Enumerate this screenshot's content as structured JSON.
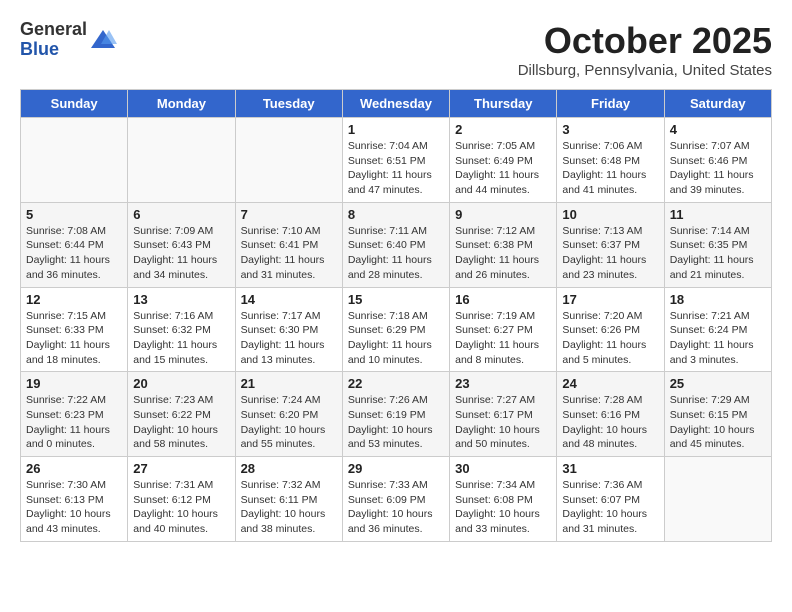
{
  "header": {
    "logo_general": "General",
    "logo_blue": "Blue",
    "month_title": "October 2025",
    "subtitle": "Dillsburg, Pennsylvania, United States"
  },
  "days_of_week": [
    "Sunday",
    "Monday",
    "Tuesday",
    "Wednesday",
    "Thursday",
    "Friday",
    "Saturday"
  ],
  "weeks": [
    [
      {
        "day": "",
        "info": ""
      },
      {
        "day": "",
        "info": ""
      },
      {
        "day": "",
        "info": ""
      },
      {
        "day": "1",
        "info": "Sunrise: 7:04 AM\nSunset: 6:51 PM\nDaylight: 11 hours and 47 minutes."
      },
      {
        "day": "2",
        "info": "Sunrise: 7:05 AM\nSunset: 6:49 PM\nDaylight: 11 hours and 44 minutes."
      },
      {
        "day": "3",
        "info": "Sunrise: 7:06 AM\nSunset: 6:48 PM\nDaylight: 11 hours and 41 minutes."
      },
      {
        "day": "4",
        "info": "Sunrise: 7:07 AM\nSunset: 6:46 PM\nDaylight: 11 hours and 39 minutes."
      }
    ],
    [
      {
        "day": "5",
        "info": "Sunrise: 7:08 AM\nSunset: 6:44 PM\nDaylight: 11 hours and 36 minutes."
      },
      {
        "day": "6",
        "info": "Sunrise: 7:09 AM\nSunset: 6:43 PM\nDaylight: 11 hours and 34 minutes."
      },
      {
        "day": "7",
        "info": "Sunrise: 7:10 AM\nSunset: 6:41 PM\nDaylight: 11 hours and 31 minutes."
      },
      {
        "day": "8",
        "info": "Sunrise: 7:11 AM\nSunset: 6:40 PM\nDaylight: 11 hours and 28 minutes."
      },
      {
        "day": "9",
        "info": "Sunrise: 7:12 AM\nSunset: 6:38 PM\nDaylight: 11 hours and 26 minutes."
      },
      {
        "day": "10",
        "info": "Sunrise: 7:13 AM\nSunset: 6:37 PM\nDaylight: 11 hours and 23 minutes."
      },
      {
        "day": "11",
        "info": "Sunrise: 7:14 AM\nSunset: 6:35 PM\nDaylight: 11 hours and 21 minutes."
      }
    ],
    [
      {
        "day": "12",
        "info": "Sunrise: 7:15 AM\nSunset: 6:33 PM\nDaylight: 11 hours and 18 minutes."
      },
      {
        "day": "13",
        "info": "Sunrise: 7:16 AM\nSunset: 6:32 PM\nDaylight: 11 hours and 15 minutes."
      },
      {
        "day": "14",
        "info": "Sunrise: 7:17 AM\nSunset: 6:30 PM\nDaylight: 11 hours and 13 minutes."
      },
      {
        "day": "15",
        "info": "Sunrise: 7:18 AM\nSunset: 6:29 PM\nDaylight: 11 hours and 10 minutes."
      },
      {
        "day": "16",
        "info": "Sunrise: 7:19 AM\nSunset: 6:27 PM\nDaylight: 11 hours and 8 minutes."
      },
      {
        "day": "17",
        "info": "Sunrise: 7:20 AM\nSunset: 6:26 PM\nDaylight: 11 hours and 5 minutes."
      },
      {
        "day": "18",
        "info": "Sunrise: 7:21 AM\nSunset: 6:24 PM\nDaylight: 11 hours and 3 minutes."
      }
    ],
    [
      {
        "day": "19",
        "info": "Sunrise: 7:22 AM\nSunset: 6:23 PM\nDaylight: 11 hours and 0 minutes."
      },
      {
        "day": "20",
        "info": "Sunrise: 7:23 AM\nSunset: 6:22 PM\nDaylight: 10 hours and 58 minutes."
      },
      {
        "day": "21",
        "info": "Sunrise: 7:24 AM\nSunset: 6:20 PM\nDaylight: 10 hours and 55 minutes."
      },
      {
        "day": "22",
        "info": "Sunrise: 7:26 AM\nSunset: 6:19 PM\nDaylight: 10 hours and 53 minutes."
      },
      {
        "day": "23",
        "info": "Sunrise: 7:27 AM\nSunset: 6:17 PM\nDaylight: 10 hours and 50 minutes."
      },
      {
        "day": "24",
        "info": "Sunrise: 7:28 AM\nSunset: 6:16 PM\nDaylight: 10 hours and 48 minutes."
      },
      {
        "day": "25",
        "info": "Sunrise: 7:29 AM\nSunset: 6:15 PM\nDaylight: 10 hours and 45 minutes."
      }
    ],
    [
      {
        "day": "26",
        "info": "Sunrise: 7:30 AM\nSunset: 6:13 PM\nDaylight: 10 hours and 43 minutes."
      },
      {
        "day": "27",
        "info": "Sunrise: 7:31 AM\nSunset: 6:12 PM\nDaylight: 10 hours and 40 minutes."
      },
      {
        "day": "28",
        "info": "Sunrise: 7:32 AM\nSunset: 6:11 PM\nDaylight: 10 hours and 38 minutes."
      },
      {
        "day": "29",
        "info": "Sunrise: 7:33 AM\nSunset: 6:09 PM\nDaylight: 10 hours and 36 minutes."
      },
      {
        "day": "30",
        "info": "Sunrise: 7:34 AM\nSunset: 6:08 PM\nDaylight: 10 hours and 33 minutes."
      },
      {
        "day": "31",
        "info": "Sunrise: 7:36 AM\nSunset: 6:07 PM\nDaylight: 10 hours and 31 minutes."
      },
      {
        "day": "",
        "info": ""
      }
    ]
  ]
}
